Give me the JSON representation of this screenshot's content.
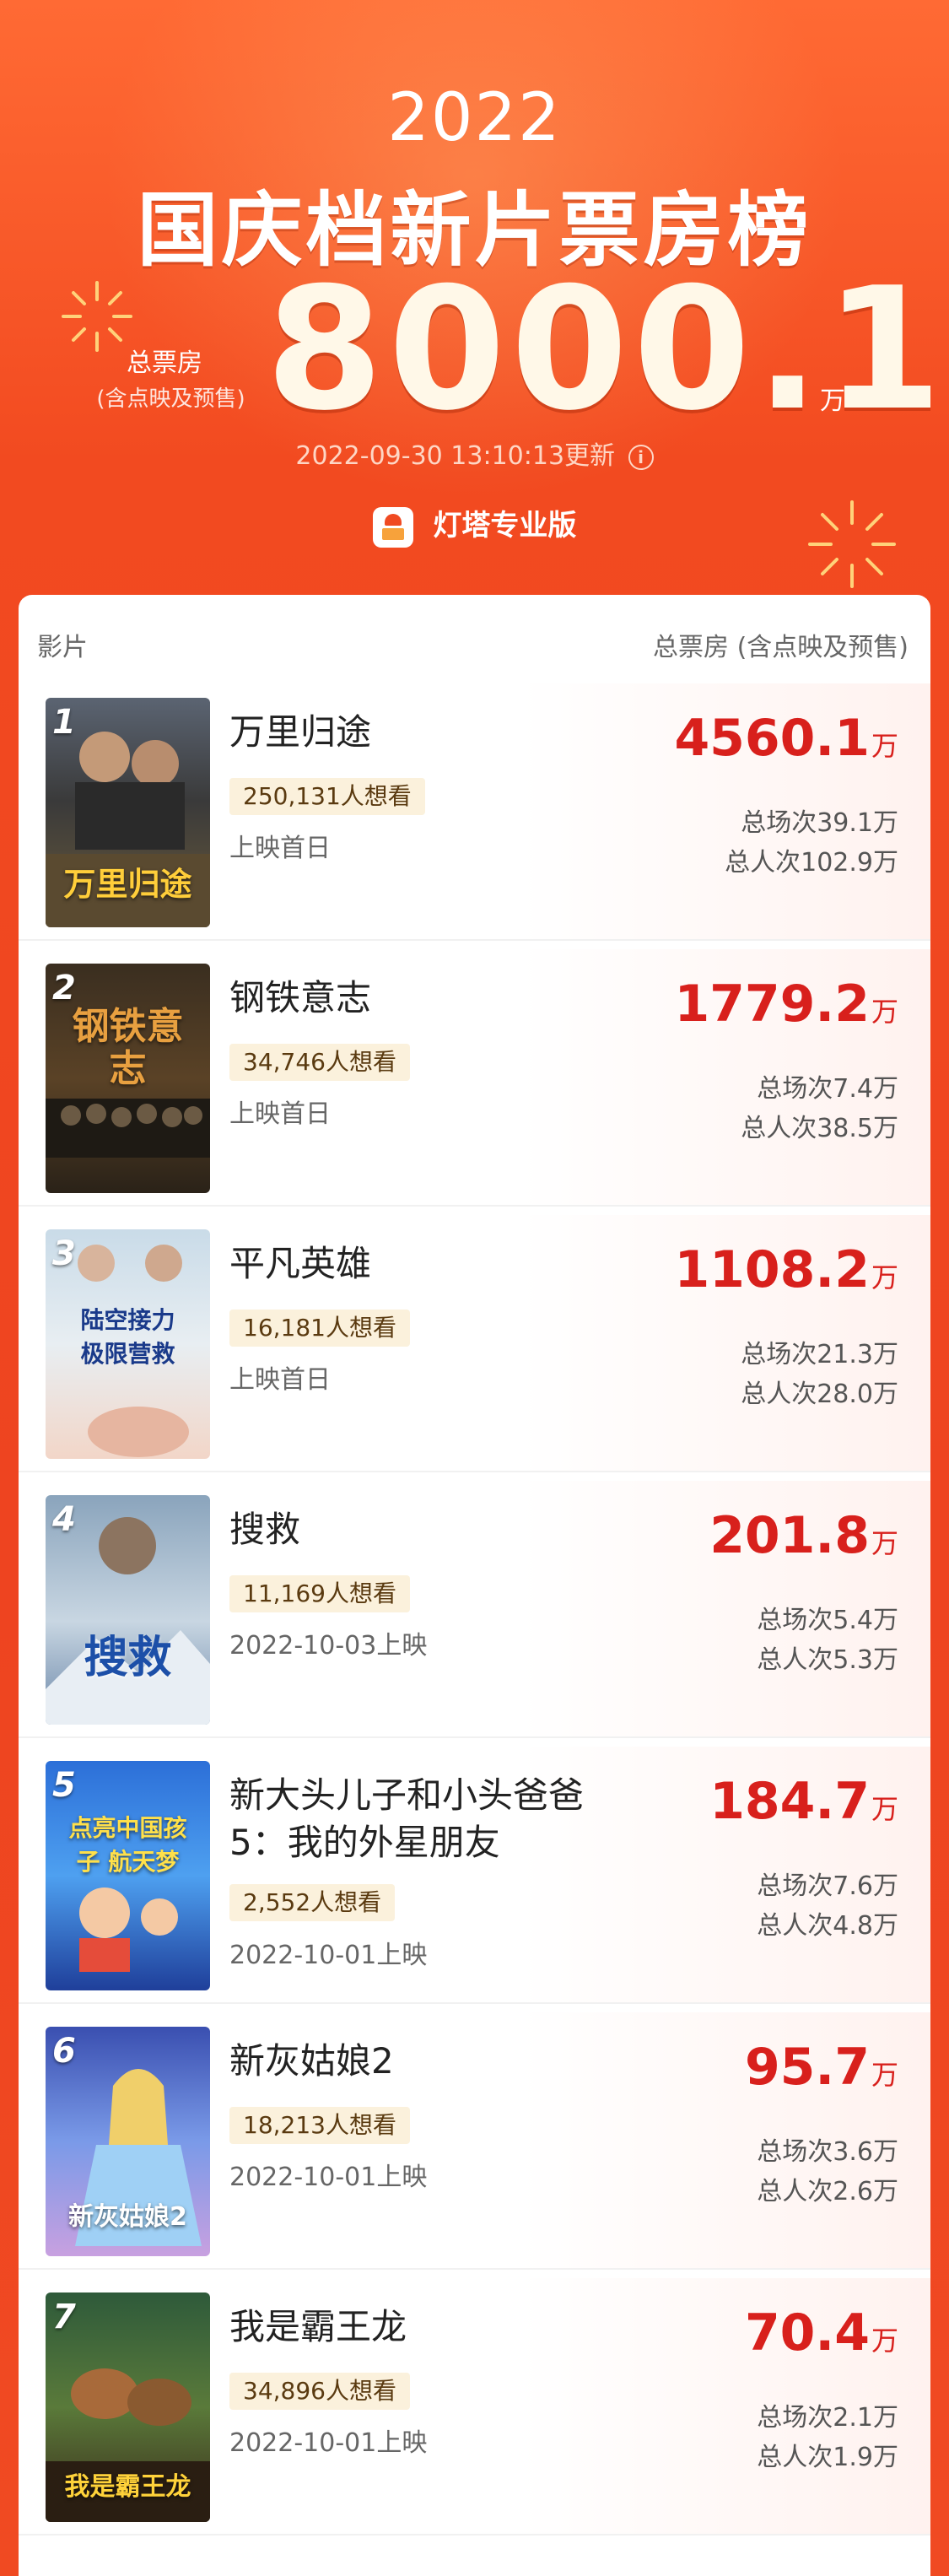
{
  "header": {
    "year": "2022",
    "title": "国庆档新片票房榜",
    "total_label": "总票房",
    "total_sub": "(含点映及预售)",
    "total_value": "8000.1",
    "total_unit": "万",
    "updated": "2022-09-30 13:10:13更新",
    "info_icon": "i",
    "brand": "灯塔专业版"
  },
  "table": {
    "col_film": "影片",
    "col_box": "总票房 (含点映及预售)"
  },
  "colors": {
    "background": "#f04a22",
    "box_value": "#d8201c",
    "want_badge": "#fbf1dc"
  },
  "movies": [
    {
      "rank": "1",
      "title": "万里归途",
      "want": "250,131人想看",
      "release": "上映首日",
      "box": "4560.1",
      "unit": "万",
      "shows": "总场次39.1万",
      "viewers": "总人次102.9万",
      "poster_text": "万里归途"
    },
    {
      "rank": "2",
      "title": "钢铁意志",
      "want": "34,746人想看",
      "release": "上映首日",
      "box": "1779.2",
      "unit": "万",
      "shows": "总场次7.4万",
      "viewers": "总人次38.5万",
      "poster_text": "钢铁意志"
    },
    {
      "rank": "3",
      "title": "平凡英雄",
      "want": "16,181人想看",
      "release": "上映首日",
      "box": "1108.2",
      "unit": "万",
      "shows": "总场次21.3万",
      "viewers": "总人次28.0万",
      "poster_text": "陆空接力 极限营救"
    },
    {
      "rank": "4",
      "title": "搜救",
      "want": "11,169人想看",
      "release": "2022-10-03上映",
      "box": "201.8",
      "unit": "万",
      "shows": "总场次5.4万",
      "viewers": "总人次5.3万",
      "poster_text": "搜救"
    },
    {
      "rank": "5",
      "title": "新大头儿子和小头爸爸5：我的外星朋友",
      "want": "2,552人想看",
      "release": "2022-10-01上映",
      "box": "184.7",
      "unit": "万",
      "shows": "总场次7.6万",
      "viewers": "总人次4.8万",
      "poster_text": "点亮中国孩子 航天梦"
    },
    {
      "rank": "6",
      "title": "新灰姑娘2",
      "want": "18,213人想看",
      "release": "2022-10-01上映",
      "box": "95.7",
      "unit": "万",
      "shows": "总场次3.6万",
      "viewers": "总人次2.6万",
      "poster_text": "新灰姑娘2"
    },
    {
      "rank": "7",
      "title": "我是霸王龙",
      "want": "34,896人想看",
      "release": "2022-10-01上映",
      "box": "70.4",
      "unit": "万",
      "shows": "总场次2.1万",
      "viewers": "总人次1.9万",
      "poster_text": "我是霸王龙"
    }
  ]
}
